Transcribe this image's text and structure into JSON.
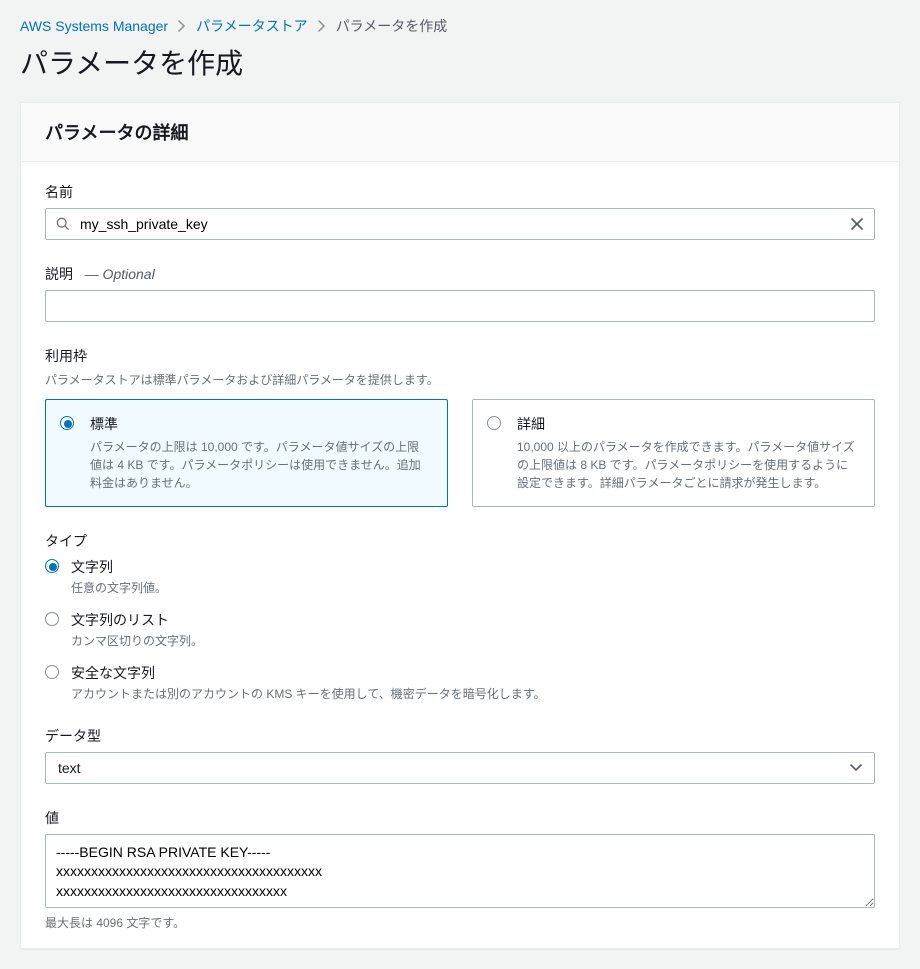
{
  "breadcrumbs": {
    "root": "AWS Systems Manager",
    "store": "パラメータストア",
    "create": "パラメータを作成"
  },
  "page_title": "パラメータを作成",
  "panel_title": "パラメータの詳細",
  "name": {
    "label": "名前",
    "value": "my_ssh_private_key"
  },
  "description": {
    "label": "説明",
    "optional_marker": "— Optional",
    "value": ""
  },
  "tier": {
    "label": "利用枠",
    "hint": "パラメータストアは標準パラメータおよび詳細パラメータを提供します。",
    "options": [
      {
        "title": "標準",
        "desc": "パラメータの上限は 10,000 です。パラメータ値サイズの上限値は 4 KB です。パラメータポリシーは使用できません。追加料金はありません。",
        "selected": true
      },
      {
        "title": "詳細",
        "desc": "10,000 以上のパラメータを作成できます。パラメータ値サイズの上限値は 8 KB です。パラメータポリシーを使用するように設定できます。詳細パラメータごとに請求が発生します。",
        "selected": false
      }
    ]
  },
  "type": {
    "label": "タイプ",
    "options": [
      {
        "title": "文字列",
        "desc": "任意の文字列値。",
        "selected": true
      },
      {
        "title": "文字列のリスト",
        "desc": "カンマ区切りの文字列。",
        "selected": false
      },
      {
        "title": "安全な文字列",
        "desc": "アカウントまたは別のアカウントの KMS キーを使用して、機密データを暗号化します。",
        "selected": false
      }
    ]
  },
  "data_type": {
    "label": "データ型",
    "value": "text"
  },
  "value": {
    "label": "値",
    "content": "-----BEGIN RSA PRIVATE KEY-----\nxxxxxxxxxxxxxxxxxxxxxxxxxxxxxxxxxxxxxx\nxxxxxxxxxxxxxxxxxxxxxxxxxxxxxxxxx",
    "maxlength_hint": "最大長は 4096 文字です。"
  }
}
